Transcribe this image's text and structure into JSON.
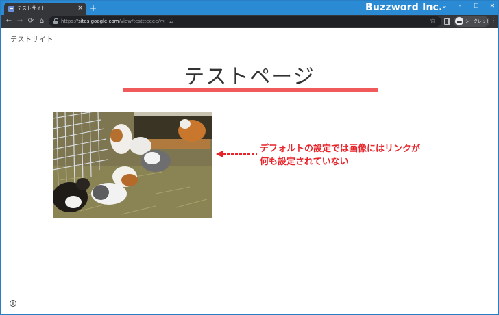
{
  "browser": {
    "tab": {
      "title": "テストサイト",
      "close_label": "×",
      "favicon": "sites-favicon-icon"
    },
    "new_tab_label": "+",
    "brand": "Buzzword Inc.",
    "window_controls": {
      "chevron": "⌄",
      "minimize": "–",
      "maximize": "☐",
      "close": "✕"
    },
    "toolbar": {
      "back": "←",
      "forward": "→",
      "reload": "⟳",
      "home": "⌂",
      "url_scheme": "https://",
      "url_host": "sites.google.com",
      "url_path": "/view/testtteeee/ホーム",
      "bookmark": "☆",
      "profile_label": "シークレット",
      "menu": "⋮"
    }
  },
  "page": {
    "site_name": "テストサイト",
    "title": "テストページ",
    "image_alt": "",
    "annotation": {
      "line1": "デフォルトの設定では画像にはリンクが",
      "line2": "何も設定されていない"
    },
    "info_label": "i"
  },
  "colors": {
    "titlebar": "#2a8ad4",
    "underline": "#f15a5a",
    "annotation": "#e8242b"
  }
}
